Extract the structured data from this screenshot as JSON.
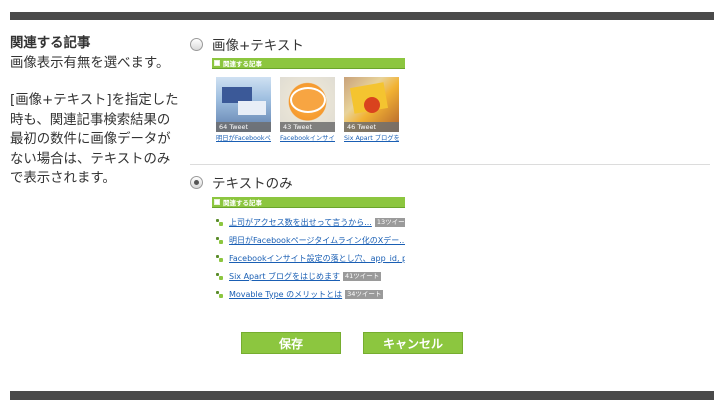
{
  "sidebar": {
    "title": "関連する記事",
    "desc_1": "画像表示有無を選べます。",
    "desc_2": "[画像+テキスト]を指定した時も、関連記事検索結果の最初の数件に画像データがない場合は、テキストのみで表示されます。"
  },
  "options": {
    "image_text": {
      "label": "画像+テキスト",
      "selected": false
    },
    "text_only": {
      "label": "テキストのみ",
      "selected": true
    }
  },
  "preview_header": "関連する記事",
  "thumbs": [
    {
      "count": "64 Tweet",
      "title": "明日がFacebookページタイムライン..."
    },
    {
      "count": "43 Tweet",
      "title": "Facebookインサイト設定の落とし穴..."
    },
    {
      "count": "46 Tweet",
      "title": "Six Apart ブログをはじめます..."
    }
  ],
  "list_items": [
    {
      "text": "上司がアクセス数を出せって言うから...",
      "badge": "13ツイート"
    },
    {
      "text": "明日がFacebookページタイムライン化のXデー...",
      "badge": ""
    },
    {
      "text": "Facebookインサイト設定の落とし穴、app_id, p",
      "badge": ""
    },
    {
      "text": "Six Apart ブログをはじめます",
      "badge": "41ツイート"
    },
    {
      "text": "Movable Type のメリットとは",
      "badge": "34ツイート"
    }
  ],
  "buttons": {
    "save": "保存",
    "cancel": "キャンセル"
  },
  "colors": {
    "accent_green": "#8cc63f",
    "bar_gray": "#4a4a4a",
    "link_blue": "#1a5fb4"
  }
}
